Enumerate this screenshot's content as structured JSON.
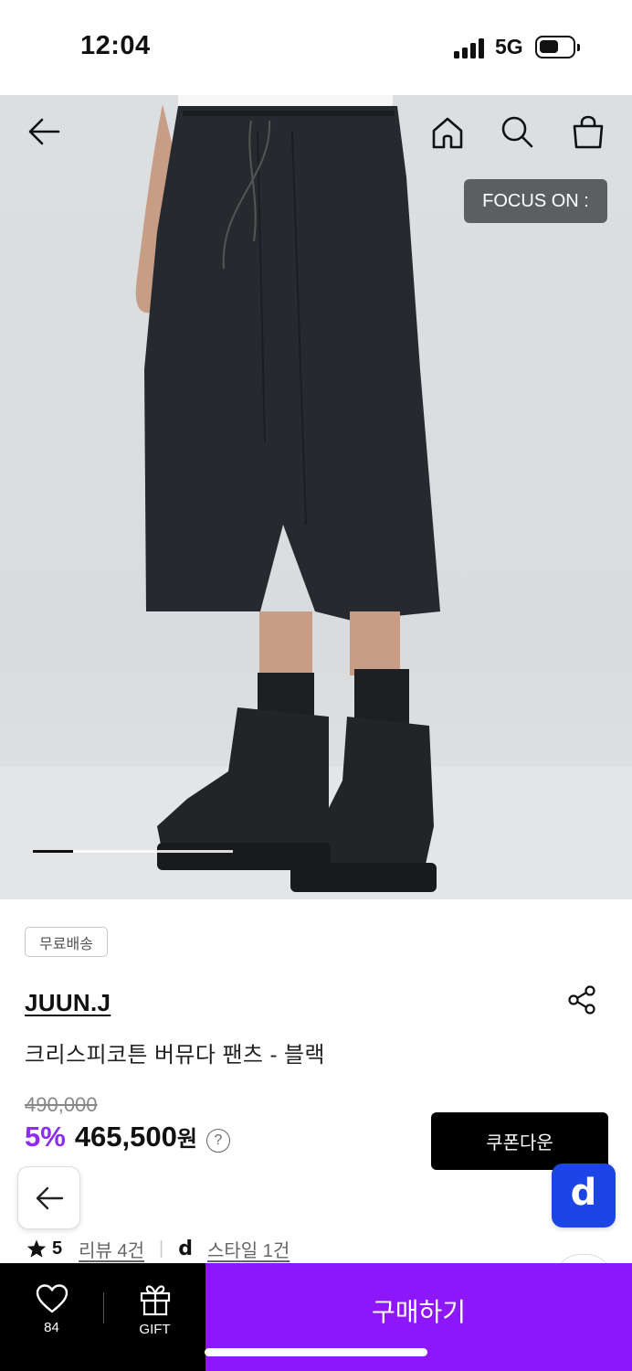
{
  "status_bar": {
    "time": "12:04",
    "network": "5G",
    "battery_level": 0.6
  },
  "header": {
    "back_icon": "arrow-left-icon",
    "home_icon": "home-icon",
    "search_icon": "search-icon",
    "cart_icon": "shopping-bag-icon",
    "focus_badge": "FOCUS ON :"
  },
  "gallery": {
    "progress": 0.2
  },
  "product": {
    "shipping_badge": "무료배송",
    "brand": "JUUN.J",
    "name": "크리스피코튼 버뮤다 팬츠 - 블랙",
    "original_price": "490,000",
    "discount": "5%",
    "price": "465,500",
    "currency": "원",
    "help": "?",
    "coupon_label": "쿠폰다운"
  },
  "rating": {
    "score": "5",
    "reviews": "리뷰 4건",
    "style_logo": "d",
    "styles": "스타일 1건"
  },
  "bottom_bar": {
    "like_count": "84",
    "gift_label": "GIFT",
    "buy_label": "구매하기"
  },
  "colors": {
    "accent": "#8d16fa",
    "discount": "#8d2cf2",
    "dbutton": "#1c45e8"
  }
}
